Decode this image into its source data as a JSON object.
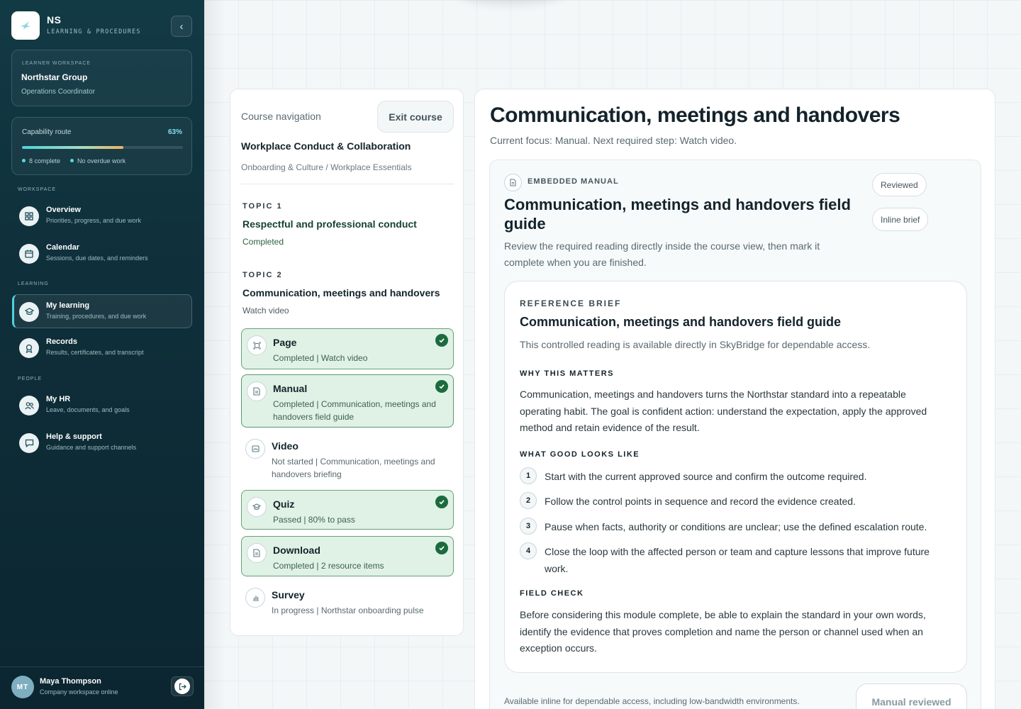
{
  "brand": {
    "name": "NS",
    "subtitle": "LEARNING & PROCEDURES"
  },
  "workspace": {
    "label": "LEARNER WORKSPACE",
    "org": "Northstar Group",
    "role": "Operations Coordinator"
  },
  "capability": {
    "label": "Capability route",
    "percent_text": "63%",
    "progress": 0.63,
    "complete": "8 complete",
    "overdue": "No overdue work"
  },
  "sidebar": {
    "sections": {
      "workspace": "WORKSPACE",
      "learning": "LEARNING",
      "people": "PEOPLE"
    },
    "items": [
      {
        "title": "Overview",
        "sub": "Priorities, progress, and due work",
        "icon": "grid-icon"
      },
      {
        "title": "Calendar",
        "sub": "Sessions, due dates, and reminders",
        "icon": "calendar-icon"
      },
      {
        "title": "My learning",
        "sub": "Training, procedures, and due work",
        "icon": "graduation-cap-icon"
      },
      {
        "title": "Records",
        "sub": "Results, certificates, and transcript",
        "icon": "award-icon"
      },
      {
        "title": "My HR",
        "sub": "Leave, documents, and goals",
        "icon": "people-icon"
      },
      {
        "title": "Help & support",
        "sub": "Guidance and support channels",
        "icon": "chat-icon"
      }
    ]
  },
  "user": {
    "initials": "MT",
    "name": "Maya Thompson",
    "status": "Company workspace online"
  },
  "course_nav": {
    "title": "Course navigation",
    "exit_label": "Exit course",
    "course_name": "Workplace Conduct & Collaboration",
    "course_path": "Onboarding & Culture / Workplace Essentials",
    "topics": [
      {
        "label": "TOPIC 1",
        "name": "Respectful and professional conduct",
        "status": "Completed"
      },
      {
        "label": "TOPIC 2",
        "name": "Communication, meetings and handovers",
        "status": "Watch video"
      }
    ],
    "steps": [
      {
        "title": "Page",
        "sub": "Completed | Watch video",
        "done": true,
        "icon": "page-icon"
      },
      {
        "title": "Manual",
        "sub": "Completed | Communication, meetings and handovers field guide",
        "done": true,
        "icon": "document-icon"
      },
      {
        "title": "Video",
        "sub": "Not started | Communication, meetings and handovers briefing",
        "done": false,
        "icon": "video-icon"
      },
      {
        "title": "Quiz",
        "sub": "Passed | 80% to pass",
        "done": true,
        "icon": "quiz-icon"
      },
      {
        "title": "Download",
        "sub": "Completed | 2 resource items",
        "done": true,
        "icon": "download-icon"
      },
      {
        "title": "Survey",
        "sub": "In progress | Northstar onboarding pulse",
        "done": false,
        "icon": "survey-icon"
      }
    ]
  },
  "main": {
    "title": "Communication, meetings and handovers",
    "focus": "Current focus: Manual. Next required step: Watch video.",
    "manual": {
      "label": "EMBEDDED MANUAL",
      "chips": [
        "Reviewed",
        "Inline brief"
      ],
      "title": "Communication, meetings and handovers field guide",
      "description": "Review the required reading directly inside the course view, then mark it complete when you are finished.",
      "brief": {
        "label": "REFERENCE BRIEF",
        "title": "Communication, meetings and handovers field guide",
        "intro": "This controlled reading is available directly in SkyBridge for dependable access.",
        "why_heading": "WHY THIS MATTERS",
        "why_text": "Communication, meetings and handovers turns the Northstar standard into a repeatable operating habit. The goal is confident action: understand the expectation, apply the approved method and retain evidence of the result.",
        "good_heading": "WHAT GOOD LOOKS LIKE",
        "good_items": [
          {
            "num": "1",
            "text": "Start with the current approved source and confirm the outcome required."
          },
          {
            "num": "2",
            "text": "Follow the control points in sequence and record the evidence created."
          },
          {
            "num": "3",
            "text": "Pause when facts, authority or conditions are unclear; use the defined escalation route."
          },
          {
            "num": "4",
            "text": "Close the loop with the affected person or team and capture lessons that improve future work."
          }
        ],
        "check_heading": "FIELD CHECK",
        "check_text": "Before considering this module complete, be able to explain the standard in your own words, identify the evidence that proves completion and name the person or channel used when an exception occurs."
      },
      "footnote": "Available inline for dependable access, including low-bandwidth environments.",
      "reviewed_label": "Manual reviewed"
    }
  }
}
